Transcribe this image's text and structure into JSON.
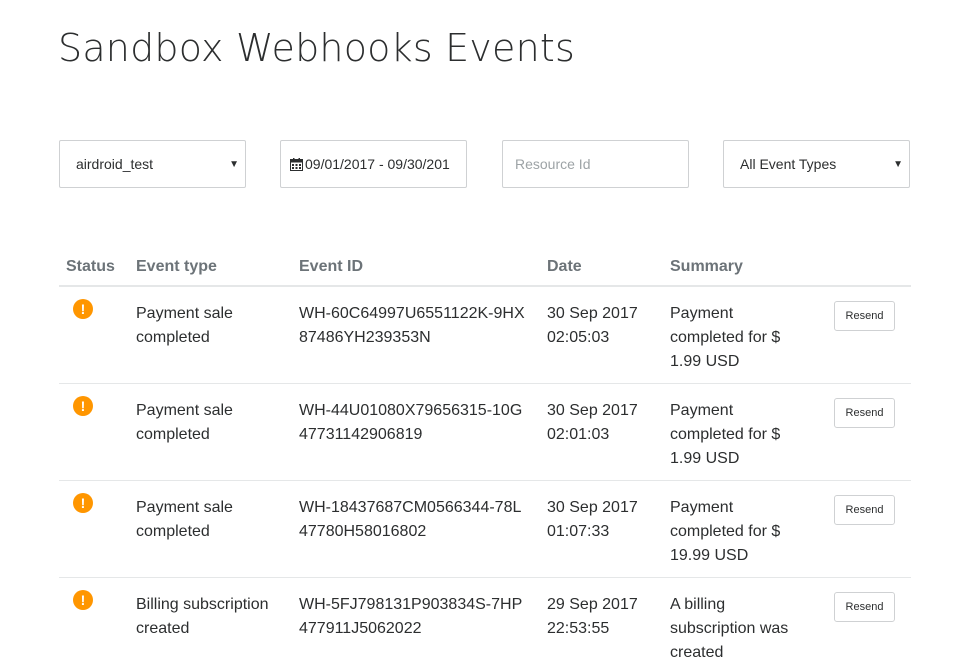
{
  "page": {
    "title": "Sandbox Webhooks Events"
  },
  "filters": {
    "app_select": "airdroid_test",
    "date_range": "09/01/2017 - 09/30/201",
    "resource_placeholder": "Resource Id",
    "event_type_select": "All Event Types"
  },
  "table": {
    "headers": {
      "status": "Status",
      "event_type": "Event type",
      "event_id": "Event ID",
      "date": "Date",
      "summary": "Summary"
    },
    "rows": [
      {
        "status_glyph": "!",
        "event_type": "Payment sale completed",
        "event_id": "WH-60C64997U6551122K-9HX87486YH239353N",
        "date": "30 Sep 2017 02:05:03",
        "summary": "Payment completed for $ 1.99 USD",
        "action": "Resend"
      },
      {
        "status_glyph": "!",
        "event_type": "Payment sale completed",
        "event_id": "WH-44U01080X79656315-10G47731142906819",
        "date": "30 Sep 2017 02:01:03",
        "summary": "Payment completed for $ 1.99 USD",
        "action": "Resend"
      },
      {
        "status_glyph": "!",
        "event_type": "Payment sale completed",
        "event_id": "WH-18437687CM0566344-78L47780H58016802",
        "date": "30 Sep 2017 01:07:33",
        "summary": "Payment completed for $ 19.99 USD",
        "action": "Resend"
      },
      {
        "status_glyph": "!",
        "event_type": "Billing subscription created",
        "event_id": "WH-5FJ798131P903834S-7HP477911J5062022",
        "date": "29 Sep 2017 22:53:55",
        "summary": "A billing subscription was created",
        "action": "Resend"
      }
    ]
  },
  "colors": {
    "warning": "#ff9600",
    "header_text": "#6c7378",
    "border": "#cfd1d3"
  },
  "icons": {
    "status": "warning-icon",
    "date": "calendar-icon",
    "select": "caret-down-icon"
  }
}
